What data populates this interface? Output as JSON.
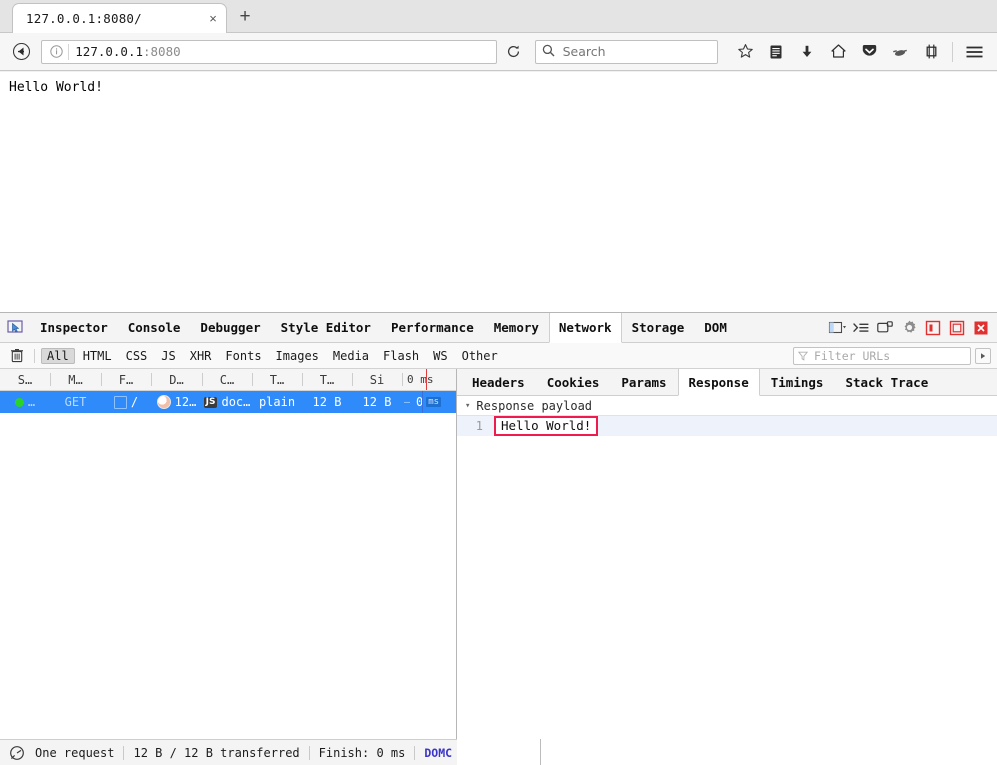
{
  "browser": {
    "tab": {
      "title": "127.0.0.1:8080/",
      "close_label": "×"
    },
    "new_tab_label": "+",
    "back_icon": "back-arrow-icon",
    "url": {
      "host": "127.0.0.1",
      "port": ":8080"
    },
    "reload_label": "↻",
    "search": {
      "placeholder": "Search",
      "value": ""
    },
    "toolbar_icons": [
      "star-icon",
      "library-icon",
      "downloads-icon",
      "home-icon",
      "pocket-icon",
      "container-icon",
      "screenshot-icon",
      "hamburger-menu-icon"
    ]
  },
  "page": {
    "body_text": "Hello World!"
  },
  "devtools": {
    "picker_icon": "element-picker-icon",
    "tabs": [
      {
        "label": "Inspector",
        "active": false
      },
      {
        "label": "Console",
        "active": false
      },
      {
        "label": "Debugger",
        "active": false
      },
      {
        "label": "Style Editor",
        "active": false
      },
      {
        "label": "Performance",
        "active": false
      },
      {
        "label": "Memory",
        "active": false
      },
      {
        "label": "Network",
        "active": true
      },
      {
        "label": "Storage",
        "active": false
      },
      {
        "label": "DOM",
        "active": false
      }
    ],
    "toolbar_right_icons": [
      "responsive-design-mode-icon",
      "split-console-icon",
      "separate-window-icon",
      "settings-gear-icon",
      "dock-bottom-icon",
      "dock-side-icon",
      "close-icon"
    ],
    "network": {
      "clear_icon": "trash-icon",
      "filters": [
        {
          "label": "All",
          "active": true
        },
        {
          "label": "HTML",
          "active": false
        },
        {
          "label": "CSS",
          "active": false
        },
        {
          "label": "JS",
          "active": false
        },
        {
          "label": "XHR",
          "active": false
        },
        {
          "label": "Fonts",
          "active": false
        },
        {
          "label": "Images",
          "active": false
        },
        {
          "label": "Media",
          "active": false
        },
        {
          "label": "Flash",
          "active": false
        },
        {
          "label": "WS",
          "active": false
        },
        {
          "label": "Other",
          "active": false
        }
      ],
      "filter_urls": {
        "placeholder": "Filter URLs",
        "value": ""
      },
      "play_label": "▶",
      "columns": [
        {
          "label": "S…",
          "title": "Status"
        },
        {
          "label": "M…",
          "title": "Method"
        },
        {
          "label": "F…",
          "title": "File"
        },
        {
          "label": "D…",
          "title": "Domain"
        },
        {
          "label": "C…",
          "title": "Cause"
        },
        {
          "label": "T…",
          "title": "Type"
        },
        {
          "label": "T…",
          "title": "Transferred"
        },
        {
          "label": "Si",
          "title": "Size"
        }
      ],
      "timeline_label": "0 ms",
      "rows": [
        {
          "status": "…",
          "method": "GET",
          "file": "/",
          "domain": "12…",
          "cause_badge": "JS",
          "cause": "doc…",
          "type": "plain",
          "transferred": "12 B",
          "size": "12 B",
          "timeline_dash": "–",
          "timeline_value": "0",
          "timeline_unit": "ms",
          "selected": true
        }
      ],
      "status_bar": {
        "monitor_icon": "network-throttle-icon",
        "requests": "One request",
        "transferred": "12 B / 12 B transferred",
        "finish": "Finish: 0 ms",
        "domcontentloaded": "DOMC"
      }
    },
    "details": {
      "tabs": [
        {
          "label": "Headers",
          "active": false
        },
        {
          "label": "Cookies",
          "active": false
        },
        {
          "label": "Params",
          "active": false
        },
        {
          "label": "Response",
          "active": true
        },
        {
          "label": "Timings",
          "active": false
        },
        {
          "label": "Stack Trace",
          "active": false
        }
      ],
      "payload_title": "Response payload",
      "twisty": "▾",
      "code": [
        {
          "line_number": "1",
          "text": "Hello World!"
        }
      ]
    }
  },
  "colors": {
    "selection_blue": "#2f8bfa",
    "highlight_red": "#ed1c4c",
    "status_green": "#29d329",
    "link_blue": "#3a35c8"
  }
}
